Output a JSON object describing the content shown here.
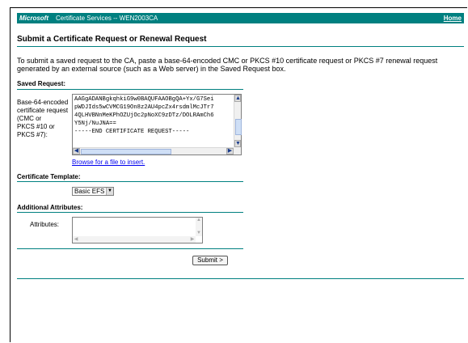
{
  "banner": {
    "brand": "Microsoft",
    "service": "Certificate Services  --  WEN2003CA",
    "home_link": "Home"
  },
  "page_title": "Submit a Certificate Request or Renewal Request",
  "intro": "To submit a saved request to the CA, paste a base-64-encoded CMC or PKCS #10 certificate request or PKCS #7 renewal request generated by an external source (such as a Web server) in the Saved Request box.",
  "saved_request": {
    "section_label": "Saved Request:",
    "field_label_lines": [
      "Base-64-encoded",
      "certificate request",
      "(CMC or",
      "PKCS #10 or",
      "PKCS #7):"
    ],
    "content": "AAGgADANBgkqhkiG9w0BAQUFAAOBgQA+Yx/G7Sei\npWDJIds5wCVMCG19On8z2AU4pcZx4rsdmlMcJTr7\n4QLHVBNnMeKPhOZUjOc2pNoXC9zDTz/DOLRAmCh6\nY5Nj/NuJNA==\n-----END CERTIFICATE REQUEST-----\n",
    "browse_link": "Browse for a file to insert."
  },
  "certificate_template": {
    "section_label": "Certificate Template:",
    "selected": "Basic EFS"
  },
  "additional_attributes": {
    "section_label": "Additional Attributes:",
    "field_label": "Attributes:",
    "value": ""
  },
  "submit_button": "Submit >",
  "colors": {
    "accent": "#008080",
    "link": "#0000ee"
  }
}
